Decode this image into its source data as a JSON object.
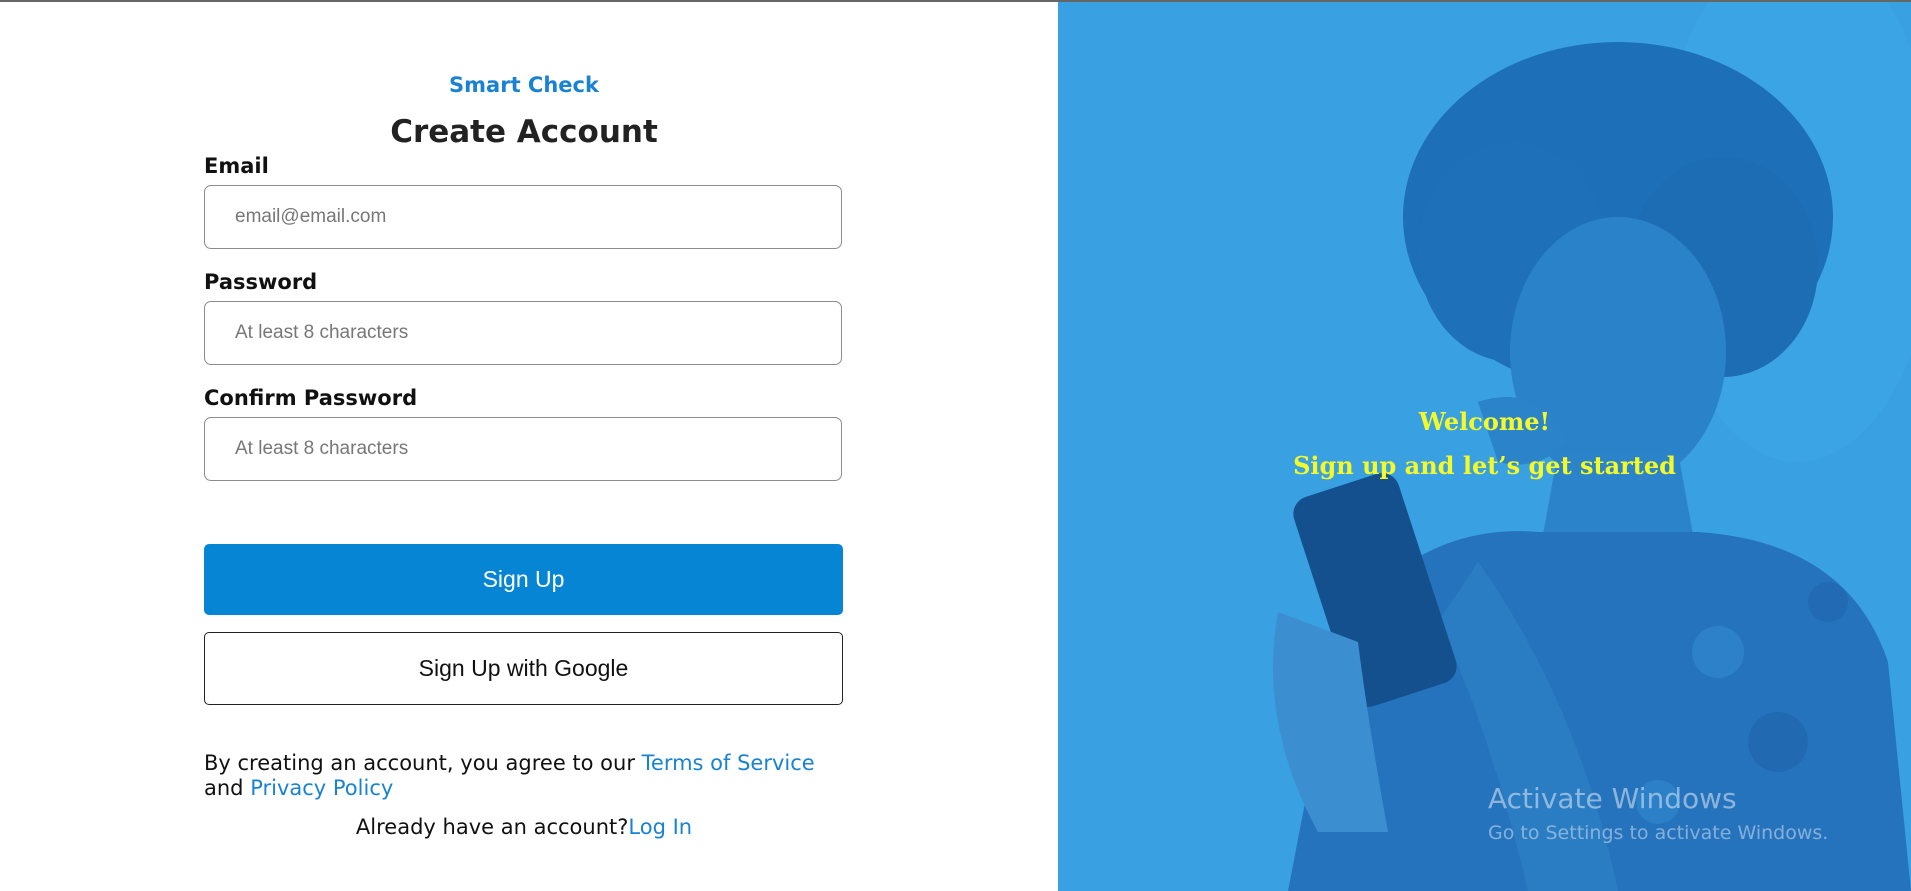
{
  "brand": {
    "name": "Smart Check",
    "accent": "#1a82d2"
  },
  "page_title": "Create Account",
  "form": {
    "email": {
      "label": "Email",
      "placeholder": "email@email.com",
      "value": ""
    },
    "password": {
      "label": "Password",
      "placeholder": "At least 8 characters",
      "value": ""
    },
    "confirm_password": {
      "label": "Confirm Password",
      "placeholder": "At least 8 characters",
      "value": ""
    },
    "signup_label": "Sign Up",
    "google_label": "Sign Up with Google"
  },
  "legal": {
    "prefix": "By creating an account, you agree to our ",
    "terms_label": "Terms of Service",
    "and": "and ",
    "privacy_label": "Privacy Policy"
  },
  "login_prompt": {
    "text": "Already have an account?",
    "link_label": "Log In"
  },
  "hero": {
    "welcome": "Welcome!",
    "tagline": "Sign up and let’s get started",
    "overlay_color": "#3aa0e2",
    "text_color": "#f4f92a"
  },
  "os_watermark": {
    "title": "Activate Windows",
    "subtitle": "Go to Settings to activate Windows."
  }
}
